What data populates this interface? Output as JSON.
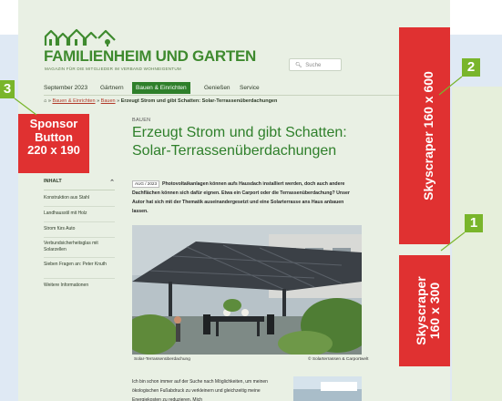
{
  "logo": {
    "title": "FAMILIENHEIM UND GARTEN",
    "subtitle": "MAGAZIN FÜR DIE MITGLIEDER IM VERBAND WOHNEIGENTUM"
  },
  "search": {
    "placeholder": "Suche",
    "icon": "search-icon"
  },
  "nav": {
    "items": [
      {
        "label": "September 2023"
      },
      {
        "label": "Gärtnern"
      },
      {
        "label": "Bauen & Einrichten",
        "active": true
      },
      {
        "label": "Genießen"
      },
      {
        "label": "Service"
      }
    ]
  },
  "breadcrumb": {
    "home_icon": "home-icon",
    "link1": "Bauen & Einrichten",
    "sep": "»",
    "link2": "Bauen",
    "current": "Erzeugt Strom und gibt Schatten: Solar-Terrassenüberdachungen"
  },
  "sponsor": {
    "line1": "Sponsor",
    "line2": "Button",
    "line3": "220 x 190"
  },
  "sidebar": {
    "heading": "INHALT",
    "items": [
      "Konstruktion aus Stahl",
      "Landhausstil mit Holz",
      "Strom fürs Auto",
      "Verbundsicherheitsglas mit Solarzellen",
      "Sieben Fragen an: Peter Knuth",
      "Weitere Informationen"
    ]
  },
  "article": {
    "category": "BAUEN",
    "title_line1": "Erzeugt Strom und gibt Schatten:",
    "title_line2": "Solar-Terrassenüberdachungen",
    "date": "AUG / 2023",
    "lead": "Photovoltaikanlagen können aufs Hausdach installiert werden, doch auch andere Dachflächen können sich dafür eignen. Etwa ein Carport oder die Terrassenüberdachung? Unser Autor hat sich mit der Thematik auseinandergesetzt und eine Solarterrasse ans Haus anbauen lassen.",
    "caption_left": "Solar-Terrassenüberdachung",
    "caption_right": "© Solarterrassen & Carportwelt",
    "body": "Ich bin schon immer auf der Suche nach Möglichkeiten, um meinen ökologischen Fußabdruck zu verkleinern und gleichzeitig meine Energiekosten zu reduzieren. Mich"
  },
  "ads": {
    "skyscraper_big": "Skyscraper 160 x 600",
    "skyscraper_small_line1": "Skyscraper",
    "skyscraper_small_line2": "160 x 300"
  },
  "badges": {
    "b1": "1",
    "b2": "2",
    "b3": "3"
  },
  "colors": {
    "accent_green": "#2e7f2a",
    "ad_red": "#e03131",
    "badge_green": "#79b52b",
    "page_bg": "#e9f0e4",
    "outer_bg": "#dfe9f4"
  }
}
